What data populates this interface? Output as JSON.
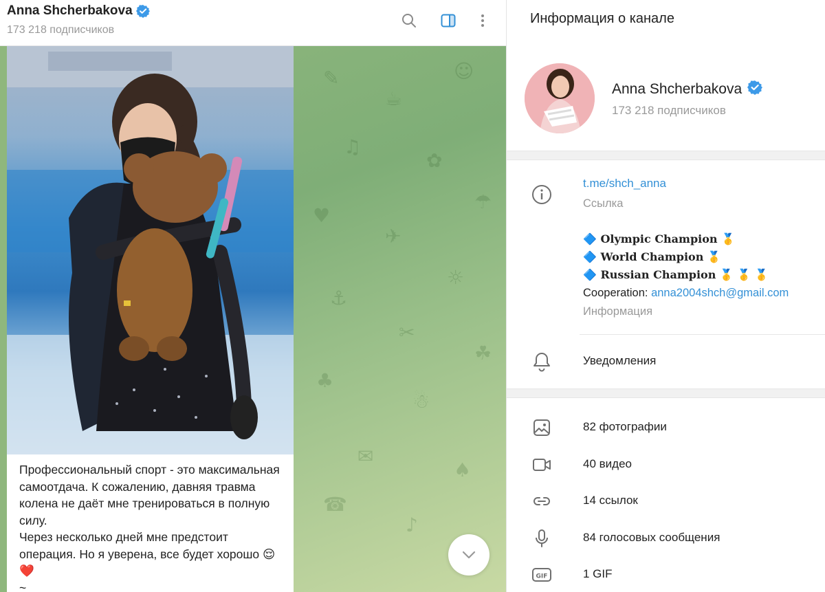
{
  "chat": {
    "channel_name": "Anna Shcherbakova",
    "subscribers": "173 218 подписчиков",
    "post_text": "Профессиональный спорт - это максимальная самоотдача. К сожалению, давняя травма колена не даёт мне тренироваться в полную силу.\nЧерез несколько дней мне предстоит операция. Но я уверена, все будет хорошо 😌❤️\n~"
  },
  "info_panel": {
    "title": "Информация о канале",
    "name": "Anna Shcherbakova",
    "subscribers": "173 218 подписчиков",
    "link": "t.me/shch_anna",
    "link_caption": "Ссылка",
    "bio_lines": [
      "🔷 Olympic Champion 🥇",
      "🔷 World Champion 🥇",
      "🔷 Russian Champion 🥇 🥇 🥇"
    ],
    "cooperation_label": "Cooperation: ",
    "email": "anna2004shch@gmail.com",
    "bio_caption": "Информация",
    "notifications": "Уведомления",
    "media": {
      "photos": "82 фотографии",
      "videos": "40 видео",
      "links": "14 ссылок",
      "voice": "84 голосовых сообщения",
      "gif": "1 GIF"
    }
  },
  "colors": {
    "accent": "#3390d6",
    "verified": "#3d9ae8",
    "muted_text": "#999999",
    "chat_background": "#8fb77d"
  },
  "icons": [
    "verified-icon",
    "search-icon",
    "sidebar-toggle-icon",
    "more-vertical-icon",
    "chevron-down-icon",
    "info-icon",
    "bell-icon",
    "image-icon",
    "video-icon",
    "link-icon",
    "microphone-icon",
    "gif-icon"
  ]
}
